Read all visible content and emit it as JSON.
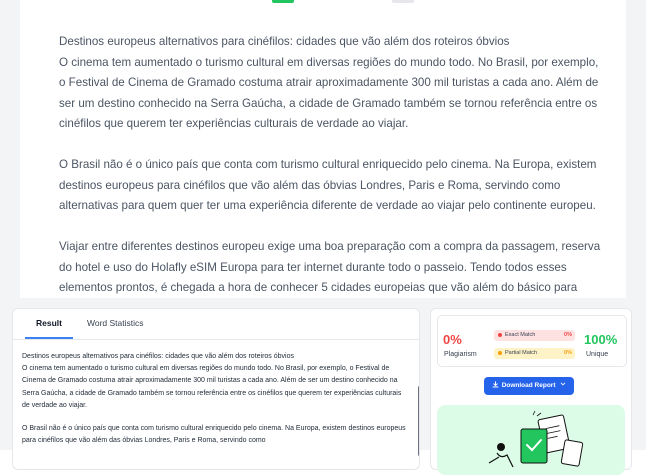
{
  "editor": {
    "paragraphs": [
      {
        "title": "Destinos europeus alternativos para cinéfilos: cidades que vão além dos roteiros óbvios",
        "text": "O cinema tem aumentado o turismo cultural em diversas regiões do mundo todo. No Brasil, por exemplo, o Festival de Cinema de Gramado costuma atrair aproximadamente 300 mil turistas a cada ano. Além de ser um destino conhecido na Serra Gaúcha, a cidade de Gramado também se tornou referência entre os cinéfilos que querem ter experiências culturais de verdade ao viajar."
      },
      {
        "text": "O Brasil não é o único país que conta com turismo cultural enriquecido pelo cinema. Na Europa, existem destinos europeus para cinéfilos que vão além das óbvias Londres, Paris e Roma, servindo como alternativas para quem quer ter uma experiência diferente de verdade ao viajar pelo continente europeu."
      },
      {
        "text": "Viajar entre diferentes destinos europeu exige uma boa preparação com a compra da passagem, reserva do hotel e uso do Holafly eSIM Europa para ter internet durante todo o passeio. Tendo todos esses elementos prontos, é chegada a hora de conhecer 5 cidades europeias que vão além do básico para"
      }
    ]
  },
  "result": {
    "tabs": [
      "Result",
      "Word Statistics"
    ],
    "paragraphs": [
      {
        "title": "Destinos europeus alternativos para cinéfilos: cidades que vão além dos roteiros óbvios",
        "text": "O cinema tem aumentado o turismo cultural em diversas regiões do mundo todo. No Brasil, por exemplo, o Festival de Cinema de Gramado costuma atrair aproximadamente 300 mil turistas a cada ano. Além de ser um destino conhecido na Serra Gaúcha, a cidade de Gramado também se tornou referência entre os cinéfilos que querem ter experiências culturais de verdade ao viajar."
      },
      {
        "text": "O Brasil não é o único país que conta com turismo cultural enriquecido pelo cinema. Na Europa, existem destinos europeus para cinéfilos que vão além das óbvias Londres, Paris e Roma, servindo como"
      }
    ]
  },
  "stats": {
    "plagiarism_pct": "0%",
    "plagiarism_label": "Plagiarism",
    "exact_label": "Exact Match",
    "exact_pct": "0%",
    "partial_label": "Partial Match",
    "partial_pct": "0%",
    "unique_pct": "100%",
    "unique_label": "Unique",
    "download_label": "Download Report"
  },
  "colors": {
    "accent": "#2563eb",
    "plagiarism": "#ef4444",
    "unique": "#22c55e",
    "partial": "#f59e0b"
  }
}
